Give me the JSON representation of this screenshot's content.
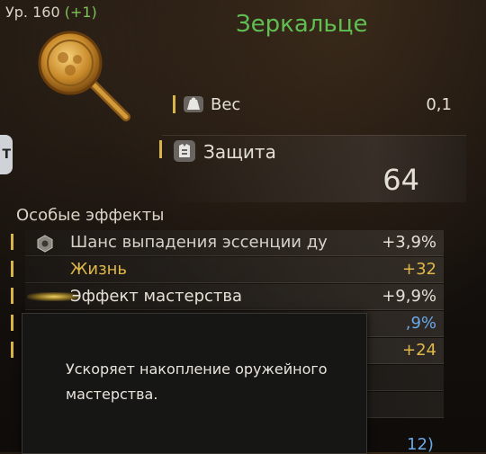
{
  "item": {
    "level_prefix": "Ур. 160",
    "level_bonus": "(+1)",
    "name": "Зеркальце",
    "name_color": "#5fbf52"
  },
  "side_tab": {
    "label": "T"
  },
  "stats": {
    "weight": {
      "label": "Вес",
      "value": "0,1",
      "icon": "weight-icon"
    },
    "defense": {
      "label": "Защита",
      "value": "64",
      "icon": "armor-icon"
    }
  },
  "effects": {
    "title": "Особые эффекты",
    "rows": [
      {
        "label": "Шанс выпадения эссенции ду",
        "value": "+3,9%",
        "icon": "rune-icon",
        "label_color": "#d6d2ca",
        "value_color": "#e5e0d6"
      },
      {
        "label": "Жизнь",
        "value": "+32",
        "icon": "",
        "label_color": "#e0b84a",
        "value_color": "#e0b84a"
      },
      {
        "label": "Эффект мастерства",
        "value": "+9,9%",
        "icon": "mastery-glow",
        "label_color": "#e5e0d6",
        "value_color": "#e5e0d6"
      }
    ],
    "hidden_values": [
      {
        "value": ",9%",
        "color": "#6aa8e8"
      },
      {
        "value": "+24",
        "color": "#e0b84a"
      },
      {
        "value": "12)",
        "color": "#6aa8e8"
      }
    ]
  },
  "tooltip": {
    "text": "Ускоряет накопление оружейного мастерства."
  },
  "colors": {
    "accent_gold": "#d8b548",
    "life_gold": "#e0b84a",
    "blue_value": "#6aa8e8"
  }
}
